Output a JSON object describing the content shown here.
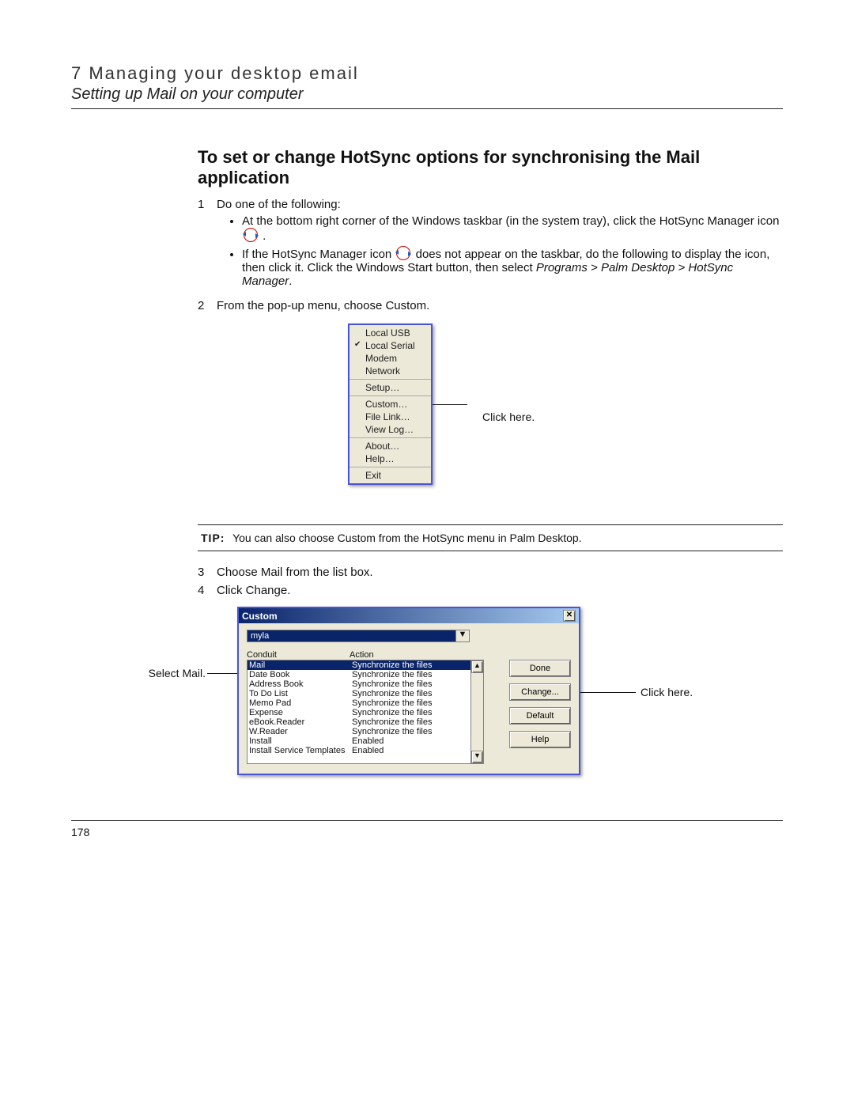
{
  "header": {
    "chapter": "7 Managing your desktop email",
    "section": "Setting up Mail on your computer"
  },
  "heading": "To set or change HotSync options for synchronising the Mail application",
  "steps": {
    "s1": {
      "num": "1",
      "text": "Do one of the following:"
    },
    "b1": "At the bottom right corner of the Windows taskbar (in the system tray), click the HotSync Manager icon ",
    "b1end": ".",
    "b2a": "If the HotSync Manager icon ",
    "b2b": " does not appear on the taskbar, do the following to display the icon, then click it. Click the Windows Start button, then select ",
    "b2path": "Programs > Palm Desktop > HotSync Manager",
    "b2end": ".",
    "s2": {
      "num": "2",
      "text": "From the pop-up menu, choose Custom."
    },
    "s3": {
      "num": "3",
      "text": "Choose Mail from the list box."
    },
    "s4": {
      "num": "4",
      "text": "Click Change."
    }
  },
  "popup": {
    "sec1": [
      "Local USB",
      "Local Serial",
      "Modem",
      "Network"
    ],
    "checkedIndex": 1,
    "sec2": [
      "Setup…"
    ],
    "sec3": [
      "Custom…",
      "File Link…",
      "View Log…"
    ],
    "sec4": [
      "About…",
      "Help…"
    ],
    "sec5": [
      "Exit"
    ]
  },
  "popupCallout": "Click here.",
  "tip": {
    "label": "TIP:",
    "text": "You can also choose Custom from the HotSync menu in Palm Desktop."
  },
  "dlg": {
    "title": "Custom",
    "user": "myla",
    "hdrConduit": "Conduit",
    "hdrAction": "Action",
    "rows": [
      {
        "c": "Mail",
        "a": "Synchronize the files",
        "sel": true
      },
      {
        "c": "Date Book",
        "a": "Synchronize the files"
      },
      {
        "c": "Address Book",
        "a": "Synchronize the files"
      },
      {
        "c": "To Do List",
        "a": "Synchronize the files"
      },
      {
        "c": "Memo Pad",
        "a": "Synchronize the files"
      },
      {
        "c": "Expense",
        "a": "Synchronize the files"
      },
      {
        "c": "eBook.Reader",
        "a": "Synchronize the files"
      },
      {
        "c": "W.Reader",
        "a": "Synchronize the files"
      },
      {
        "c": "Install",
        "a": "Enabled"
      },
      {
        "c": "Install Service Templates",
        "a": "Enabled"
      }
    ],
    "btns": {
      "done": "Done",
      "change": "Change...",
      "default": "Default",
      "help": "Help"
    }
  },
  "calloutSelectMail": "Select Mail.",
  "calloutClickHere": "Click here.",
  "pageNumber": "178"
}
